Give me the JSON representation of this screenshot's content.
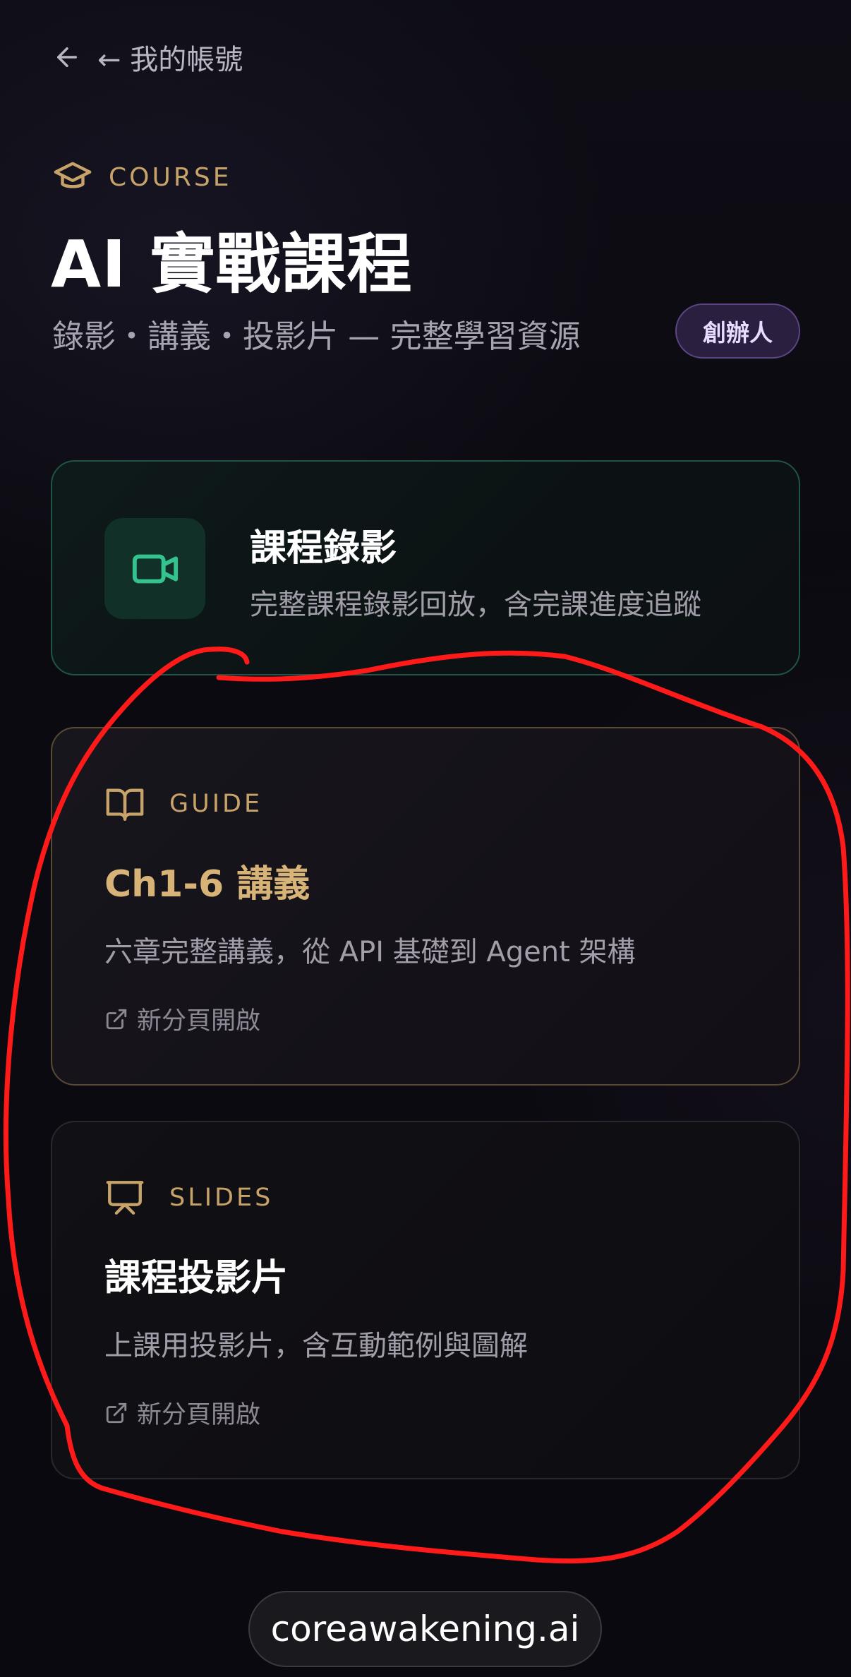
{
  "nav": {
    "back_label": "← 我的帳號"
  },
  "header": {
    "eyebrow": "COURSE",
    "title": "AI 實戰課程",
    "subtitle": "錄影・講義・投影片 — 完整學習資源",
    "badge": "創辦人"
  },
  "cards": {
    "video": {
      "title": "課程錄影",
      "description": "完整課程錄影回放，含完課進度追蹤",
      "icon": "video-camera-icon"
    },
    "guide": {
      "kicker": "GUIDE",
      "title": "Ch1-6 講義",
      "description": "六章完整講義，從 API 基礎到 Agent 架構",
      "open_label": "新分頁開啟",
      "icon": "book-icon"
    },
    "slides": {
      "kicker": "SLIDES",
      "title": "課程投影片",
      "description": "上課用投影片，含互動範例與圖解",
      "open_label": "新分頁開啟",
      "icon": "presentation-icon"
    }
  },
  "footer": {
    "url": "coreawakening.ai"
  },
  "colors": {
    "accent_gold": "#c7a36a",
    "accent_green": "#34c38f",
    "badge_purple": "#5b4585",
    "annotation_red": "#ff1a1a"
  }
}
